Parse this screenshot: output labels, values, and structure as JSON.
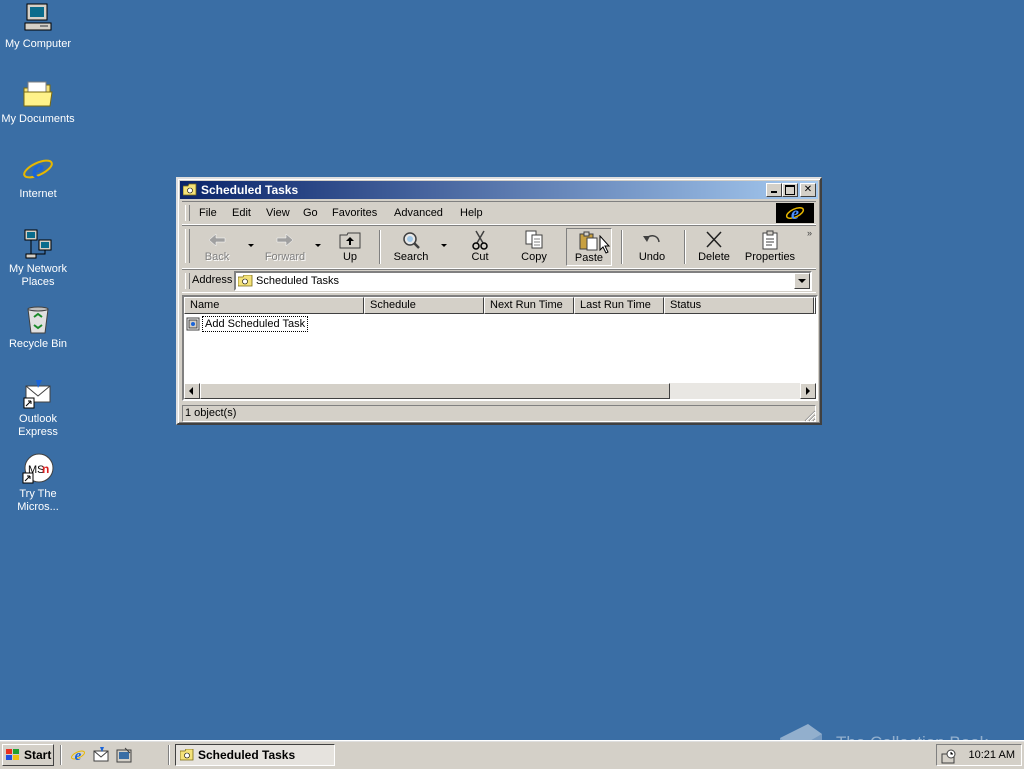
{
  "desktop": {
    "icons": [
      {
        "label": "My Computer",
        "icon": "computer-icon"
      },
      {
        "label": "My Documents",
        "icon": "folder-icon"
      },
      {
        "label": "Internet",
        "icon": "ie-icon"
      },
      {
        "label": "My Network Places",
        "icon": "network-icon"
      },
      {
        "label": "Recycle Bin",
        "icon": "recycle-bin-icon"
      },
      {
        "label": "Outlook Express",
        "icon": "outlook-express-icon"
      },
      {
        "label": "Try The Micros...",
        "icon": "msn-icon"
      }
    ]
  },
  "window": {
    "title": "Scheduled Tasks",
    "menu": [
      "File",
      "Edit",
      "View",
      "Go",
      "Favorites",
      "Advanced",
      "Help"
    ],
    "toolbar": {
      "back": "Back",
      "forward": "Forward",
      "up": "Up",
      "search": "Search",
      "cut": "Cut",
      "copy": "Copy",
      "paste": "Paste",
      "undo": "Undo",
      "delete": "Delete",
      "properties": "Properties"
    },
    "address": {
      "label": "Address",
      "value": "Scheduled Tasks"
    },
    "columns": [
      "Name",
      "Schedule",
      "Next Run Time",
      "Last Run Time",
      "Status"
    ],
    "rows": [
      {
        "name": "Add Scheduled Task"
      }
    ],
    "status": "1 object(s)"
  },
  "taskbar": {
    "start": "Start",
    "task": "Scheduled Tasks",
    "clock": "10:21 AM"
  },
  "watermark": "The Collection Book",
  "colors": {
    "desktop": "#3a6ea5",
    "title_active": "#0a246a",
    "face": "#d4d0c8"
  }
}
